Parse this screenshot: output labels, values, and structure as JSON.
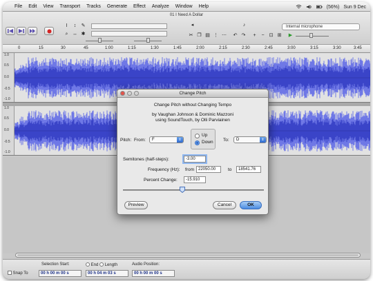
{
  "menubar": {
    "apple": "",
    "items": [
      "File",
      "Edit",
      "View",
      "Transport",
      "Tracks",
      "Generate",
      "Effect",
      "Analyze",
      "Window",
      "Help"
    ],
    "battery": "(56%)",
    "clock": "Sun 9 Dec"
  },
  "window": {
    "title": "01 I Need A Dollar",
    "input_device": "Internal microphone"
  },
  "ruler": {
    "ticks": [
      "0",
      "15",
      "30",
      "45",
      "1:00",
      "1:15",
      "1:30",
      "1:45",
      "2:00",
      "2:15",
      "2:30",
      "2:45",
      "3:00",
      "3:15",
      "3:30",
      "3:45"
    ]
  },
  "tracks": {
    "scale": [
      "1.0",
      "0.5",
      "0.0",
      "-0.5",
      "-1.0"
    ]
  },
  "dialog": {
    "title": "Change Pitch",
    "heading": "Change Pitch without Changing Tempo",
    "credit_line1": "by Vaughan Johnson & Dominic Mazzoni",
    "credit_line2": "using SoundTouch, by Olli Parviainen",
    "pitch_label": "Pitch:",
    "from_label": "From:",
    "from_value": "F",
    "up_label": "Up",
    "down_label": "Down",
    "to_label": "To:",
    "to_value": "D",
    "semitones_label": "Semitones (half-steps):",
    "semitones_value": "-3.00",
    "frequency_label": "Frequency (Hz):",
    "freq_from_label": "from",
    "freq_from_value": "22050.00",
    "freq_to_label": "to",
    "freq_to_value": "18541.76",
    "percent_label": "Percent Change:",
    "percent_value": "-15.910",
    "preview_label": "Preview",
    "cancel_label": "Cancel",
    "ok_label": "OK"
  },
  "selection": {
    "snap_label": "Snap To",
    "start_label": "Selection Start:",
    "end_label": "End",
    "length_label": "Length",
    "position_label": "Audio Position:",
    "start_time": "00 h 00 m 00 s",
    "end_time": "00 h 04 m 03 s",
    "position_time": "00 h 00 m 00 s"
  },
  "colors": {
    "waveform": "#3a44c8",
    "waveform_light": "#6f78e6",
    "accent": "#4b8be0"
  }
}
